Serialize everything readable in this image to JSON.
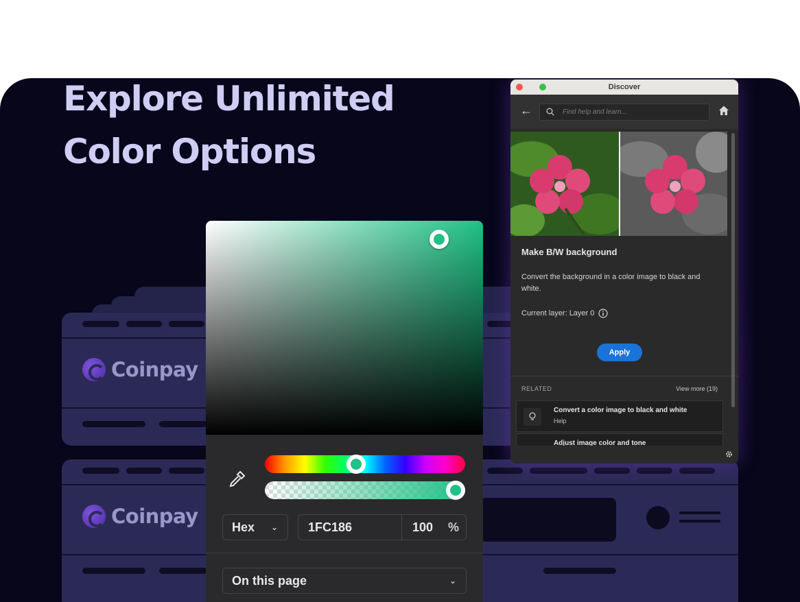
{
  "hero": {
    "line1": "Explore Unlimited",
    "line2": "Color Options"
  },
  "cards": {
    "brand_name": "Coinpay"
  },
  "picker": {
    "format": "Hex",
    "hex_value": "1FC186",
    "opacity": "100",
    "percent_symbol": "%",
    "scope": "On this page",
    "hue_position": 0.45,
    "alpha_position": 1.0,
    "accent": "#1FC186"
  },
  "discover": {
    "window_title": "Discover",
    "search_placeholder": "Find help and learn...",
    "card_title": "Make B/W background",
    "card_desc": "Convert the background in a color image to black and white.",
    "current_layer": "Current layer: Layer 0",
    "apply_label": "Apply",
    "related_heading": "RELATED",
    "view_more": "View more (19)",
    "related": [
      {
        "title": "Convert a color image to black and white",
        "sub": "Help"
      },
      {
        "title": "Adjust image color and tone",
        "sub": ""
      }
    ]
  },
  "colors": {
    "background": "#07061A",
    "card": "#2B2A57",
    "title": "#CFCDF4",
    "apply_button": "#1A73D9"
  }
}
